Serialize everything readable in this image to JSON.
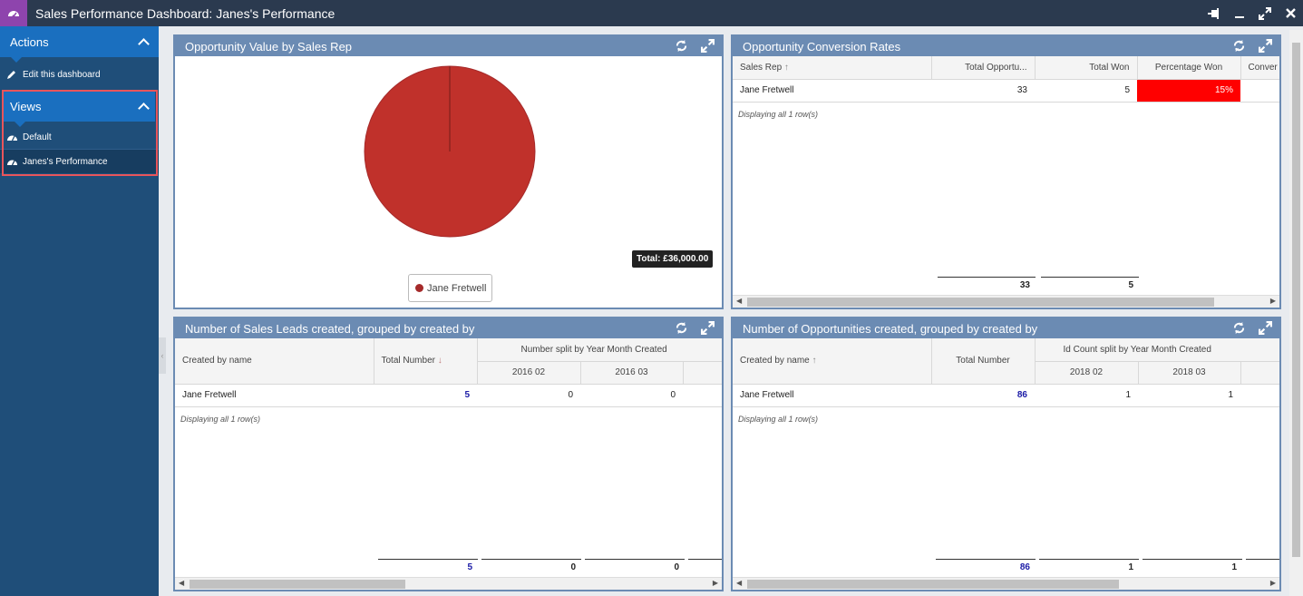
{
  "window": {
    "title": "Sales Performance Dashboard: Janes's Performance"
  },
  "sidebar": {
    "actions_header": "Actions",
    "actions": [
      {
        "label": "Edit this dashboard"
      }
    ],
    "views_header": "Views",
    "views": [
      {
        "label": "Default"
      },
      {
        "label": "Janes's Performance"
      }
    ]
  },
  "panels": {
    "pie": {
      "title": "Opportunity Value by Sales Rep",
      "total_label": "Total: £36,000.00",
      "legend": "Jane Fretwell"
    },
    "conversion": {
      "title": "Opportunity Conversion Rates",
      "columns": [
        "Sales Rep",
        "Total Opportu...",
        "Total Won",
        "Percentage Won",
        "Conver"
      ],
      "row": [
        "Jane Fretwell",
        "33",
        "5",
        "15%"
      ],
      "displaying": "Displaying all 1 row(s)",
      "totals": [
        "33",
        "5"
      ]
    },
    "leads": {
      "title": "Number of Sales Leads created, grouped by created by",
      "col_name": "Created by name",
      "col_total": "Total Number",
      "col_split": "Number split by Year Month Created",
      "sub_cols": [
        "2016 02",
        "2016 03"
      ],
      "row": [
        "Jane Fretwell",
        "5",
        "0",
        "0"
      ],
      "displaying": "Displaying all 1 row(s)",
      "totals": [
        "5",
        "0",
        "0"
      ]
    },
    "opps": {
      "title": "Number of Opportunities created, grouped by created by",
      "col_name": "Created by name",
      "col_total": "Total Number",
      "col_split": "Id Count split by Year Month Created",
      "sub_cols": [
        "2018 02",
        "2018 03"
      ],
      "row": [
        "Jane Fretwell",
        "86",
        "1",
        "1"
      ],
      "displaying": "Displaying all 1 row(s)",
      "totals": [
        "86",
        "1",
        "1"
      ]
    }
  },
  "chart_data": {
    "type": "pie",
    "title": "Opportunity Value by Sales Rep",
    "labels": [
      "Jane Fretwell"
    ],
    "values": [
      36000
    ],
    "colors": [
      "#c0312b"
    ]
  },
  "colors": {
    "accent": "#1a6fbf",
    "panel_header": "#6b8bb3",
    "highlight_red": "#ff0000"
  }
}
